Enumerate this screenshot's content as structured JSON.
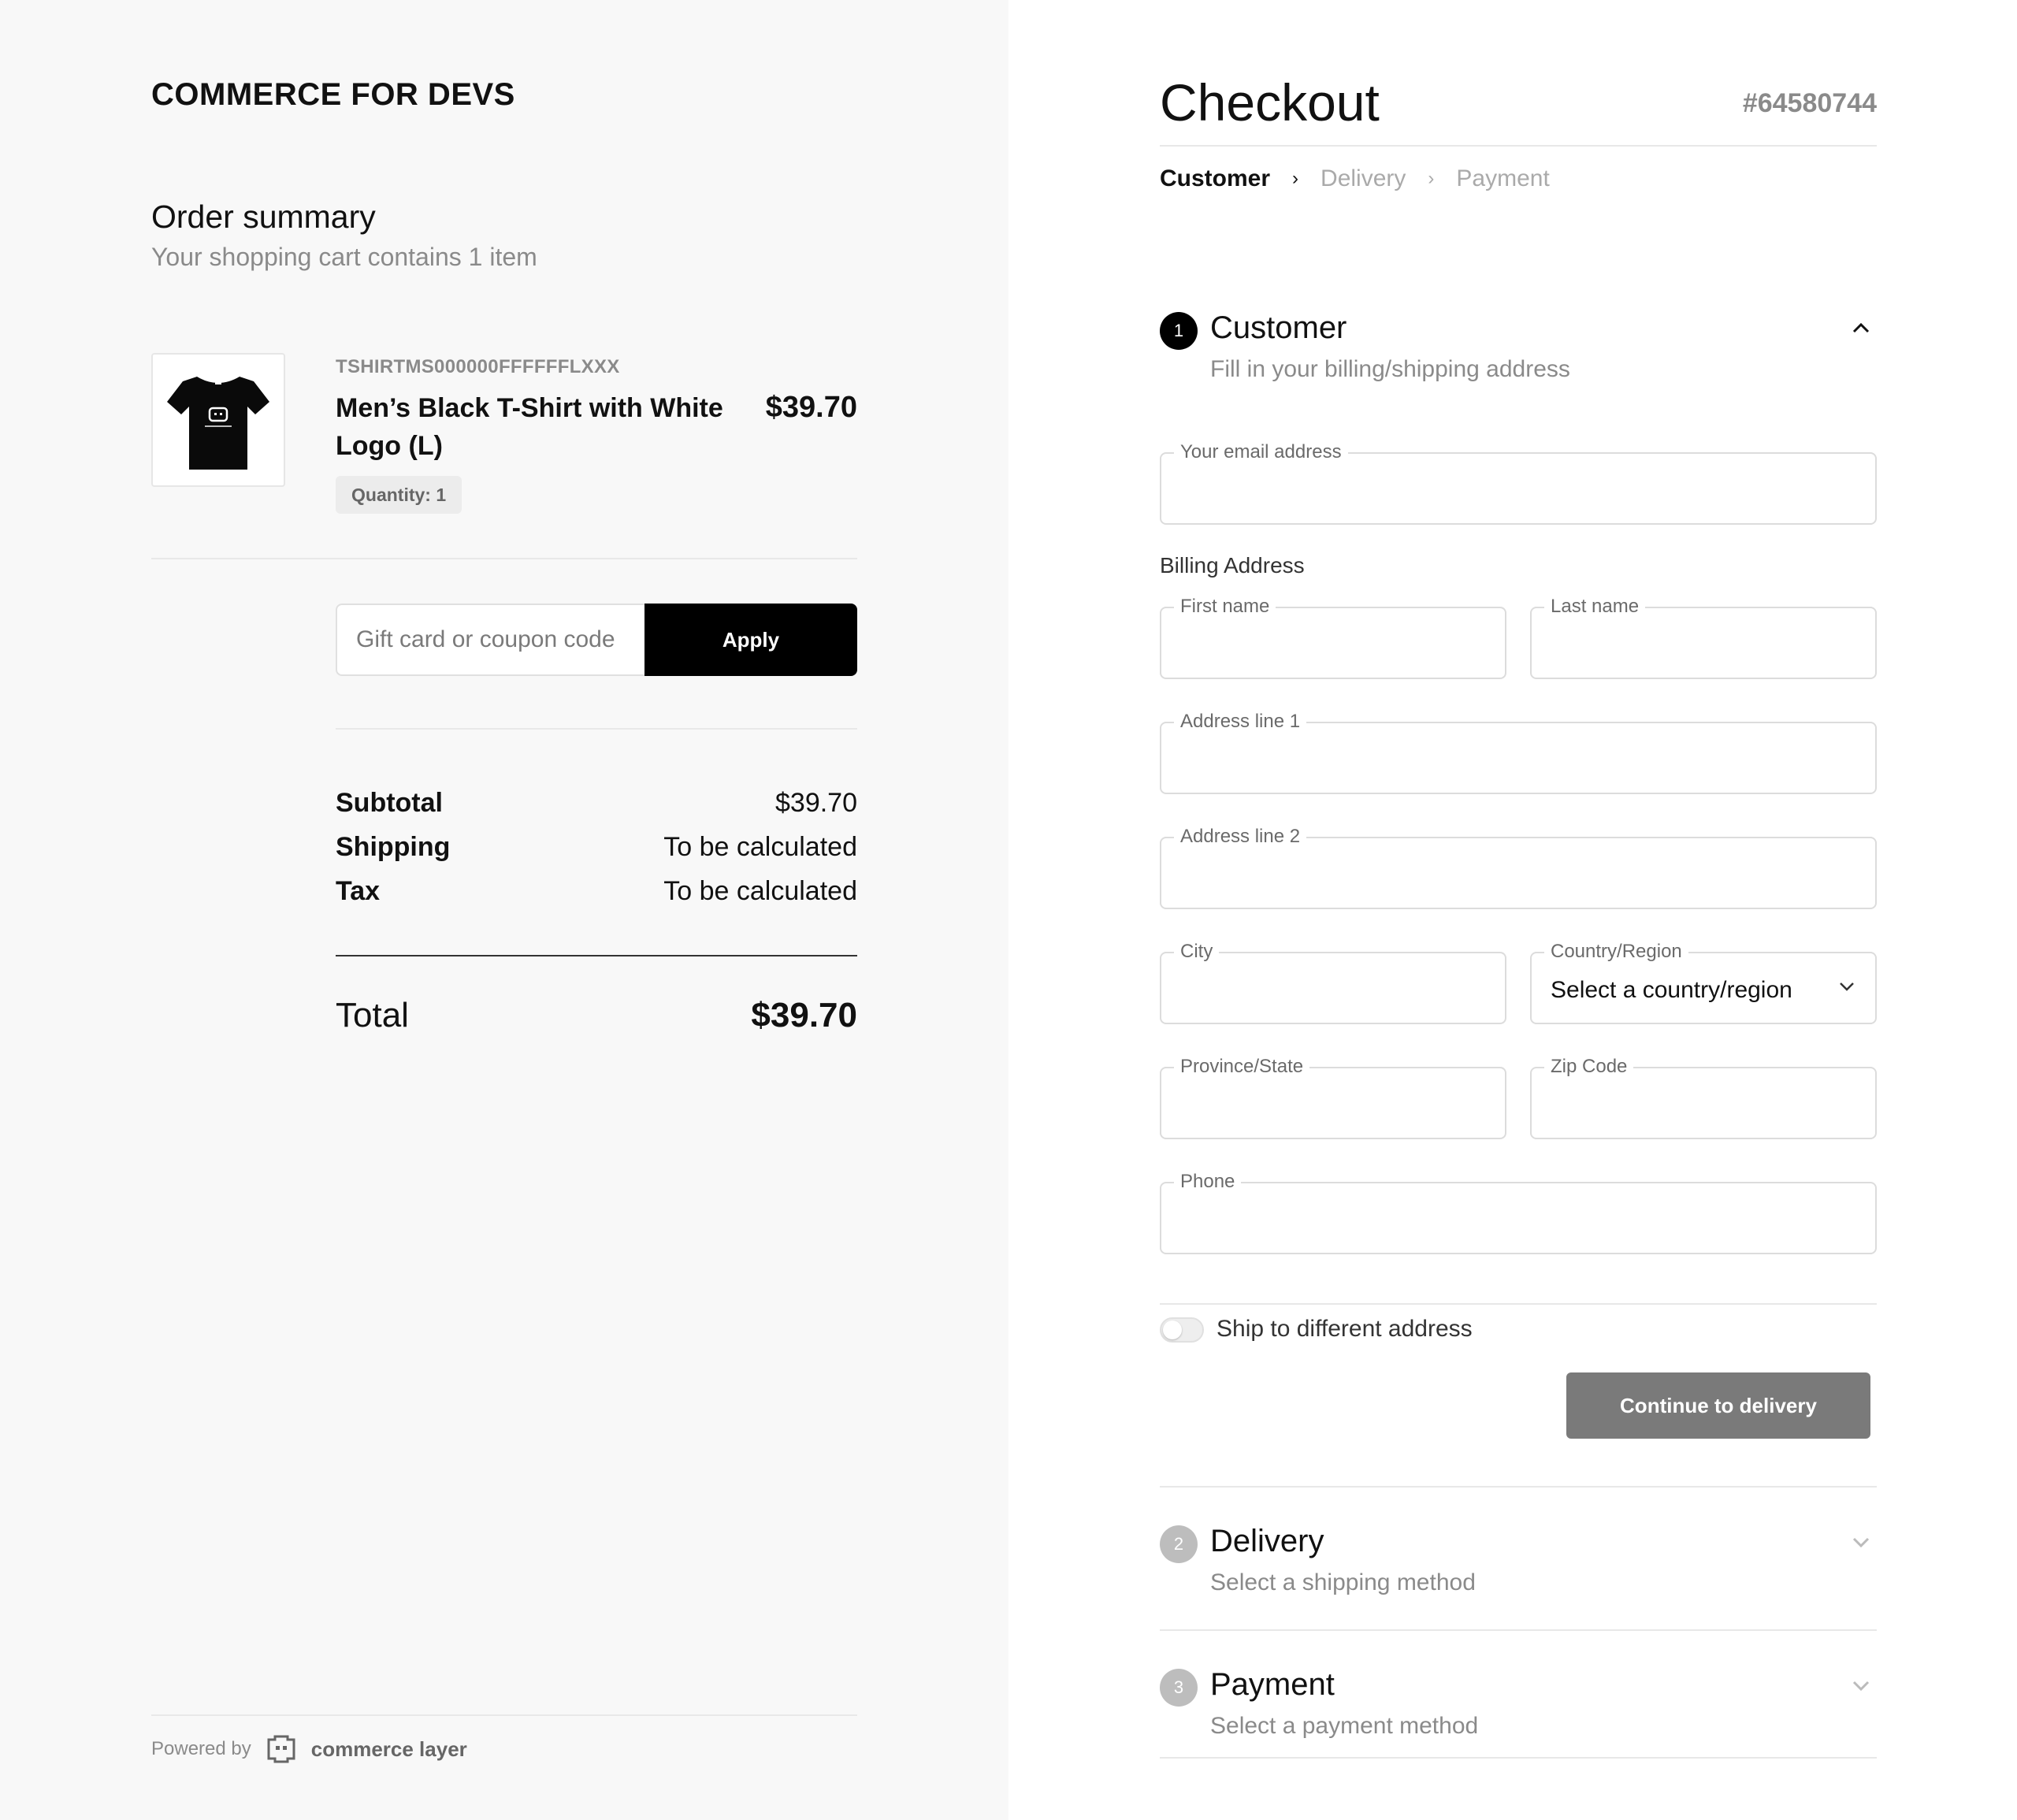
{
  "brand": "COMMERCE FOR DEVS",
  "order_summary": {
    "title": "Order summary",
    "subtitle": "Your shopping cart contains 1 item"
  },
  "item": {
    "sku": "TSHIRTMS000000FFFFFFLXXX",
    "name": "Men’s Black T-Shirt with White Logo (L)",
    "price": "$39.70",
    "quantity_label": "Quantity: 1"
  },
  "coupon": {
    "placeholder": "Gift card or coupon code",
    "value": "",
    "apply_label": "Apply"
  },
  "totals": {
    "subtotal_label": "Subtotal",
    "subtotal_value": "$39.70",
    "shipping_label": "Shipping",
    "shipping_value": "To be calculated",
    "tax_label": "Tax",
    "tax_value": "To be calculated",
    "total_label": "Total",
    "total_value": "$39.70"
  },
  "footer": {
    "powered_by": "Powered by",
    "provider": "commerce layer"
  },
  "checkout": {
    "title": "Checkout",
    "order_number": "#64580744",
    "breadcrumbs": [
      "Customer",
      "Delivery",
      "Payment"
    ],
    "steps": [
      {
        "number": "1",
        "title": "Customer",
        "subtitle": "Fill in your billing/shipping address",
        "state": "open"
      },
      {
        "number": "2",
        "title": "Delivery",
        "subtitle": "Select a shipping method",
        "state": "collapsed"
      },
      {
        "number": "3",
        "title": "Payment",
        "subtitle": "Select a payment method",
        "state": "collapsed"
      }
    ],
    "billing_address_label": "Billing Address",
    "fields": {
      "email": {
        "label": "Your email address",
        "value": ""
      },
      "first_name": {
        "label": "First name",
        "value": ""
      },
      "last_name": {
        "label": "Last name",
        "value": ""
      },
      "address1": {
        "label": "Address line 1",
        "value": ""
      },
      "address2": {
        "label": "Address line 2",
        "value": ""
      },
      "city": {
        "label": "City",
        "value": ""
      },
      "country": {
        "label": "Country/Region",
        "selected": "Select a country/region"
      },
      "state": {
        "label": "Province/State",
        "value": ""
      },
      "zip": {
        "label": "Zip Code",
        "value": ""
      },
      "phone": {
        "label": "Phone",
        "value": ""
      }
    },
    "ship_to_different": {
      "label": "Ship to different address",
      "checked": false
    },
    "continue_label": "Continue to delivery"
  },
  "colors": {
    "left_bg": "#f8f8f8",
    "primary_button": "#000000",
    "disabled_button": "#7a7a7a",
    "active_step_badge": "#000000",
    "inactive_step_badge": "#bdbdbd",
    "muted_text": "#8a8a8a"
  }
}
